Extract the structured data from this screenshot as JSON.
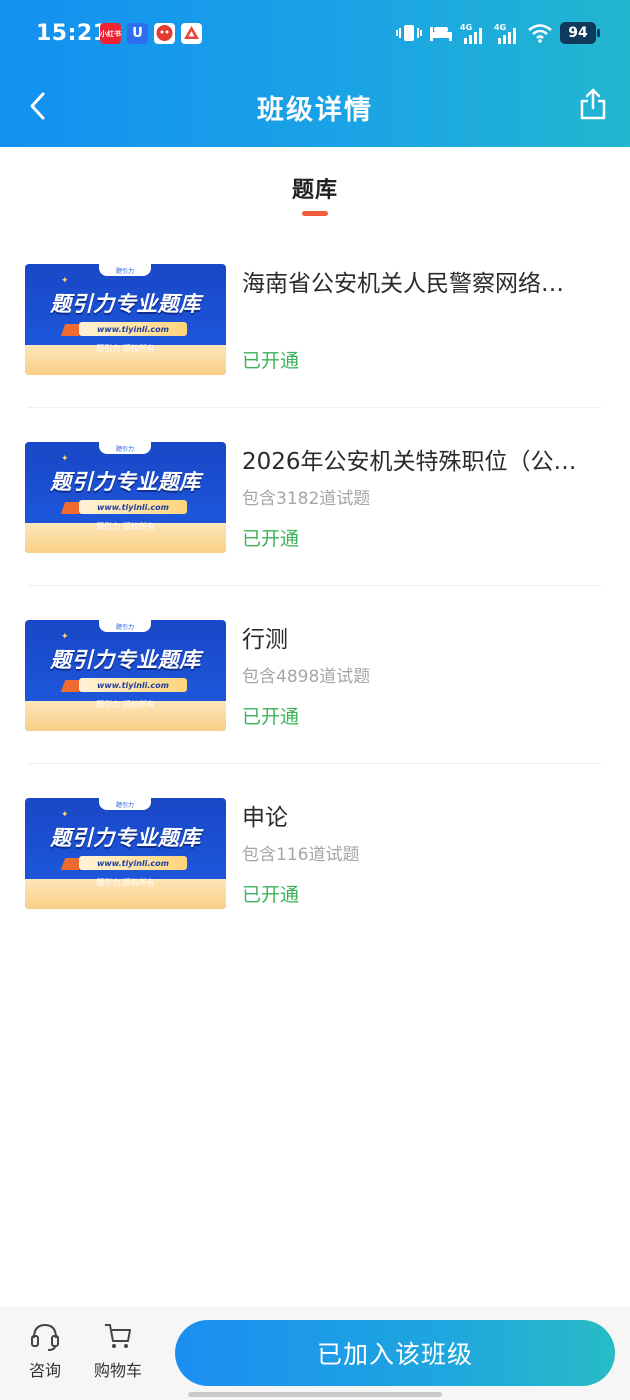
{
  "status_bar": {
    "time": "15:21",
    "app_icons": [
      {
        "name": "xiaohongshu-app-icon",
        "text": "小红书",
        "color": "#ee2436"
      },
      {
        "name": "blue-u-app-icon",
        "text": "U",
        "color": "#2f6df0"
      },
      {
        "name": "red-mascot-app-icon",
        "text": "",
        "color": "#e43a2f"
      },
      {
        "name": "red-triangle-app-icon",
        "text": "",
        "color": "#e8453c"
      }
    ],
    "network_1": "4G",
    "network_2": "4G",
    "battery": "94"
  },
  "nav": {
    "title": "班级详情",
    "back_icon": "chevron-left-icon",
    "share_icon": "share-icon"
  },
  "section": {
    "tab_label": "题库",
    "underline_color": "#ef5d3a"
  },
  "thumbnail": {
    "title": "题引力专业题库",
    "url": "www.tiyinli.com",
    "copyright": "题引力 版权所有",
    "brand": "题引力"
  },
  "items": [
    {
      "title": "海南省公安机关人民警察网络…",
      "subtitle": "",
      "status": "已开通"
    },
    {
      "title": "2026年公安机关特殊职位（公…",
      "subtitle": "包含3182道试题",
      "status": "已开通"
    },
    {
      "title": "行测",
      "subtitle": "包含4898道试题",
      "status": "已开通"
    },
    {
      "title": "申论",
      "subtitle": "包含116道试题",
      "status": "已开通"
    }
  ],
  "bottom_bar": {
    "consult_label": "咨询",
    "cart_label": "购物车",
    "join_label": "已加入该班级"
  },
  "colors": {
    "header_start": "#1390f0",
    "header_end": "#22b6cf",
    "status_green": "#3cb35a",
    "button_start": "#1b8ef2",
    "button_end": "#27bcc5"
  }
}
